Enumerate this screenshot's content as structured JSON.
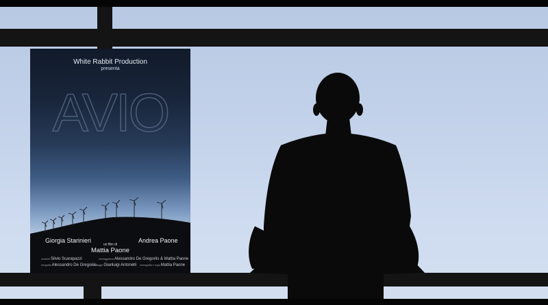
{
  "poster": {
    "producer": "White Rabbit Production",
    "presents": "presenta",
    "title": "AVIO",
    "actor_left": "Giorgia Starinieri",
    "actor_right": "Andrea Paone",
    "film_by": "un film di",
    "director": "Mattia Paone",
    "credits": [
      {
        "role": "musiche",
        "name": "Silvio Scarapazzi"
      },
      {
        "role": "sceneggiatura",
        "name": "Alessandro De Gregoriis & Mattia Paone"
      },
      {
        "role": "fotografia",
        "name": "Alessandro De Gregoriis"
      },
      {
        "role": "montaggio",
        "name": "Gianluigi Antonelli"
      },
      {
        "role": "scenografia e regia",
        "name": "Mattia Paone"
      }
    ]
  },
  "colors": {
    "sky": "#c3d2ea",
    "frame": "#141414",
    "silhouette": "#0a0a0a"
  }
}
